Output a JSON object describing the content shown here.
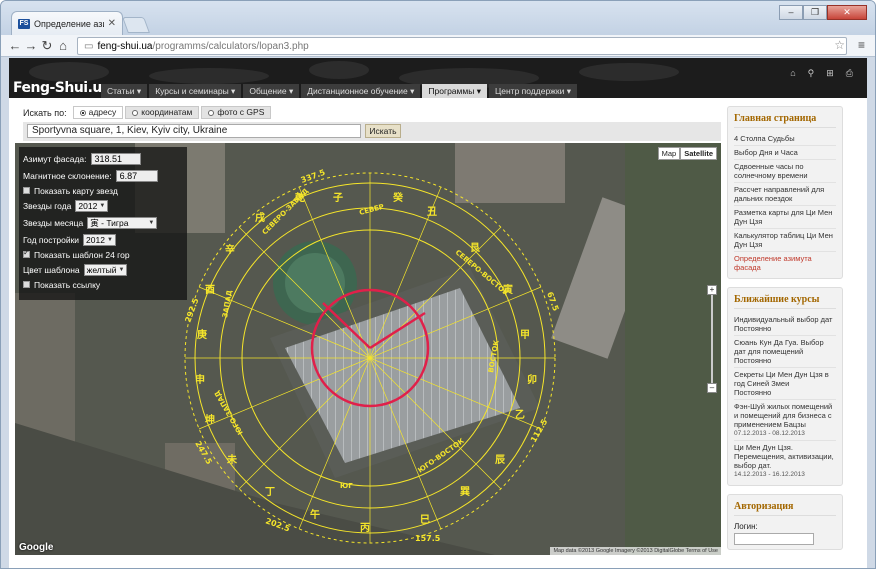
{
  "browser": {
    "tab_title": "Определение азимута ф",
    "tab_favicon": "FS",
    "url_host": "feng-shui.ua",
    "url_path": "/programms/calculators/lopan3.php",
    "win_minimize": "–",
    "win_restore": "❐",
    "win_close": "✕"
  },
  "site": {
    "logo": "Feng-Shui.ua",
    "nav": [
      "Статьи",
      "Курсы и семинары",
      "Общение",
      "Дистанционное обучение",
      "Программы",
      "Центр поддержки"
    ],
    "nav_active_index": 4
  },
  "search": {
    "label": "Искать по:",
    "tabs": [
      "адресу",
      "координатам",
      "фото с GPS"
    ],
    "active_tab_index": 0,
    "address_value": "Sportyvna square, 1, Kiev, Kyiv city, Ukraine",
    "find_button": "Искать"
  },
  "controls": {
    "azimuth_label": "Азимут фасада:",
    "azimuth_value": "318.51",
    "declination_label": "Магнитное склонение:",
    "declination_value": "6.87",
    "show_stars_map": "Показать карту звезд",
    "year_stars_label": "Звезды года",
    "year_stars_value": "2012",
    "month_stars_label": "Звезды месяца",
    "month_stars_value": "寅 - Тигра",
    "build_year_label": "Год постройки",
    "build_year_value": "2012",
    "show_24_template": "Показать шаблон 24 гор",
    "template_color_label": "Цвет шаблона",
    "template_color_value": "желтый",
    "show_link": "Показать ссылку"
  },
  "map": {
    "type_map": "Map",
    "type_satellite": "Satellite",
    "zoom_in": "+",
    "zoom_out": "–",
    "google": "Google",
    "credit": "Map data ©2013 Google Imagery ©2013 DigitalGlobe  Terms of Use",
    "compass_labels": [
      "СЕВЕР",
      "СЕВЕРО-ЗАПАД",
      "ЗАПАД",
      "ЮГО-ЗАПАД",
      "ЮГ",
      "ЮГО-ВОСТОК",
      "ВОСТОК",
      "СЕВЕРО-ВОСТОК"
    ],
    "degree_labels": [
      "337.5",
      "292.5",
      "67.5",
      "112.5",
      "157.5",
      "202.5",
      "247.5"
    ],
    "template_color": "#f5e52a",
    "arrow_color": "#e0204a"
  },
  "sidebar": {
    "main_title": "Главная страница",
    "main_links": [
      "4 Столпа Судьбы",
      "Выбор Дня и Часа",
      "Сдвоенные часы по солнечному времени",
      "Рассчет направлений для дальних поездок",
      "Разметка карты для Ци Мен Дун Цзя",
      "Калькулятор таблиц Ци Мен Дун Цзя",
      "Определение азимута фасада"
    ],
    "current_link_index": 6,
    "courses_title": "Ближайшие курсы",
    "courses": [
      {
        "name": "Индивидуальный выбор дат",
        "date": "Постоянно"
      },
      {
        "name": "Сюань Кун Да Гуа. Выбор дат для помещений",
        "date": "Постоянно"
      },
      {
        "name": "Секреты Ци Мен Дун Цзя в год Синей Змеи",
        "date": "Постоянно"
      },
      {
        "name": "Фэн-Шуй жилых помещений и помещений для бизнеса с применением Бацзы",
        "date": "07.12.2013 - 08.12.2013"
      },
      {
        "name": "Ци Мен Дун Цзя. Перемещения, активизации, выбор дат.",
        "date": "14.12.2013 - 16.12.2013"
      }
    ],
    "auth_title": "Авторизация",
    "login_label": "Логин:"
  }
}
